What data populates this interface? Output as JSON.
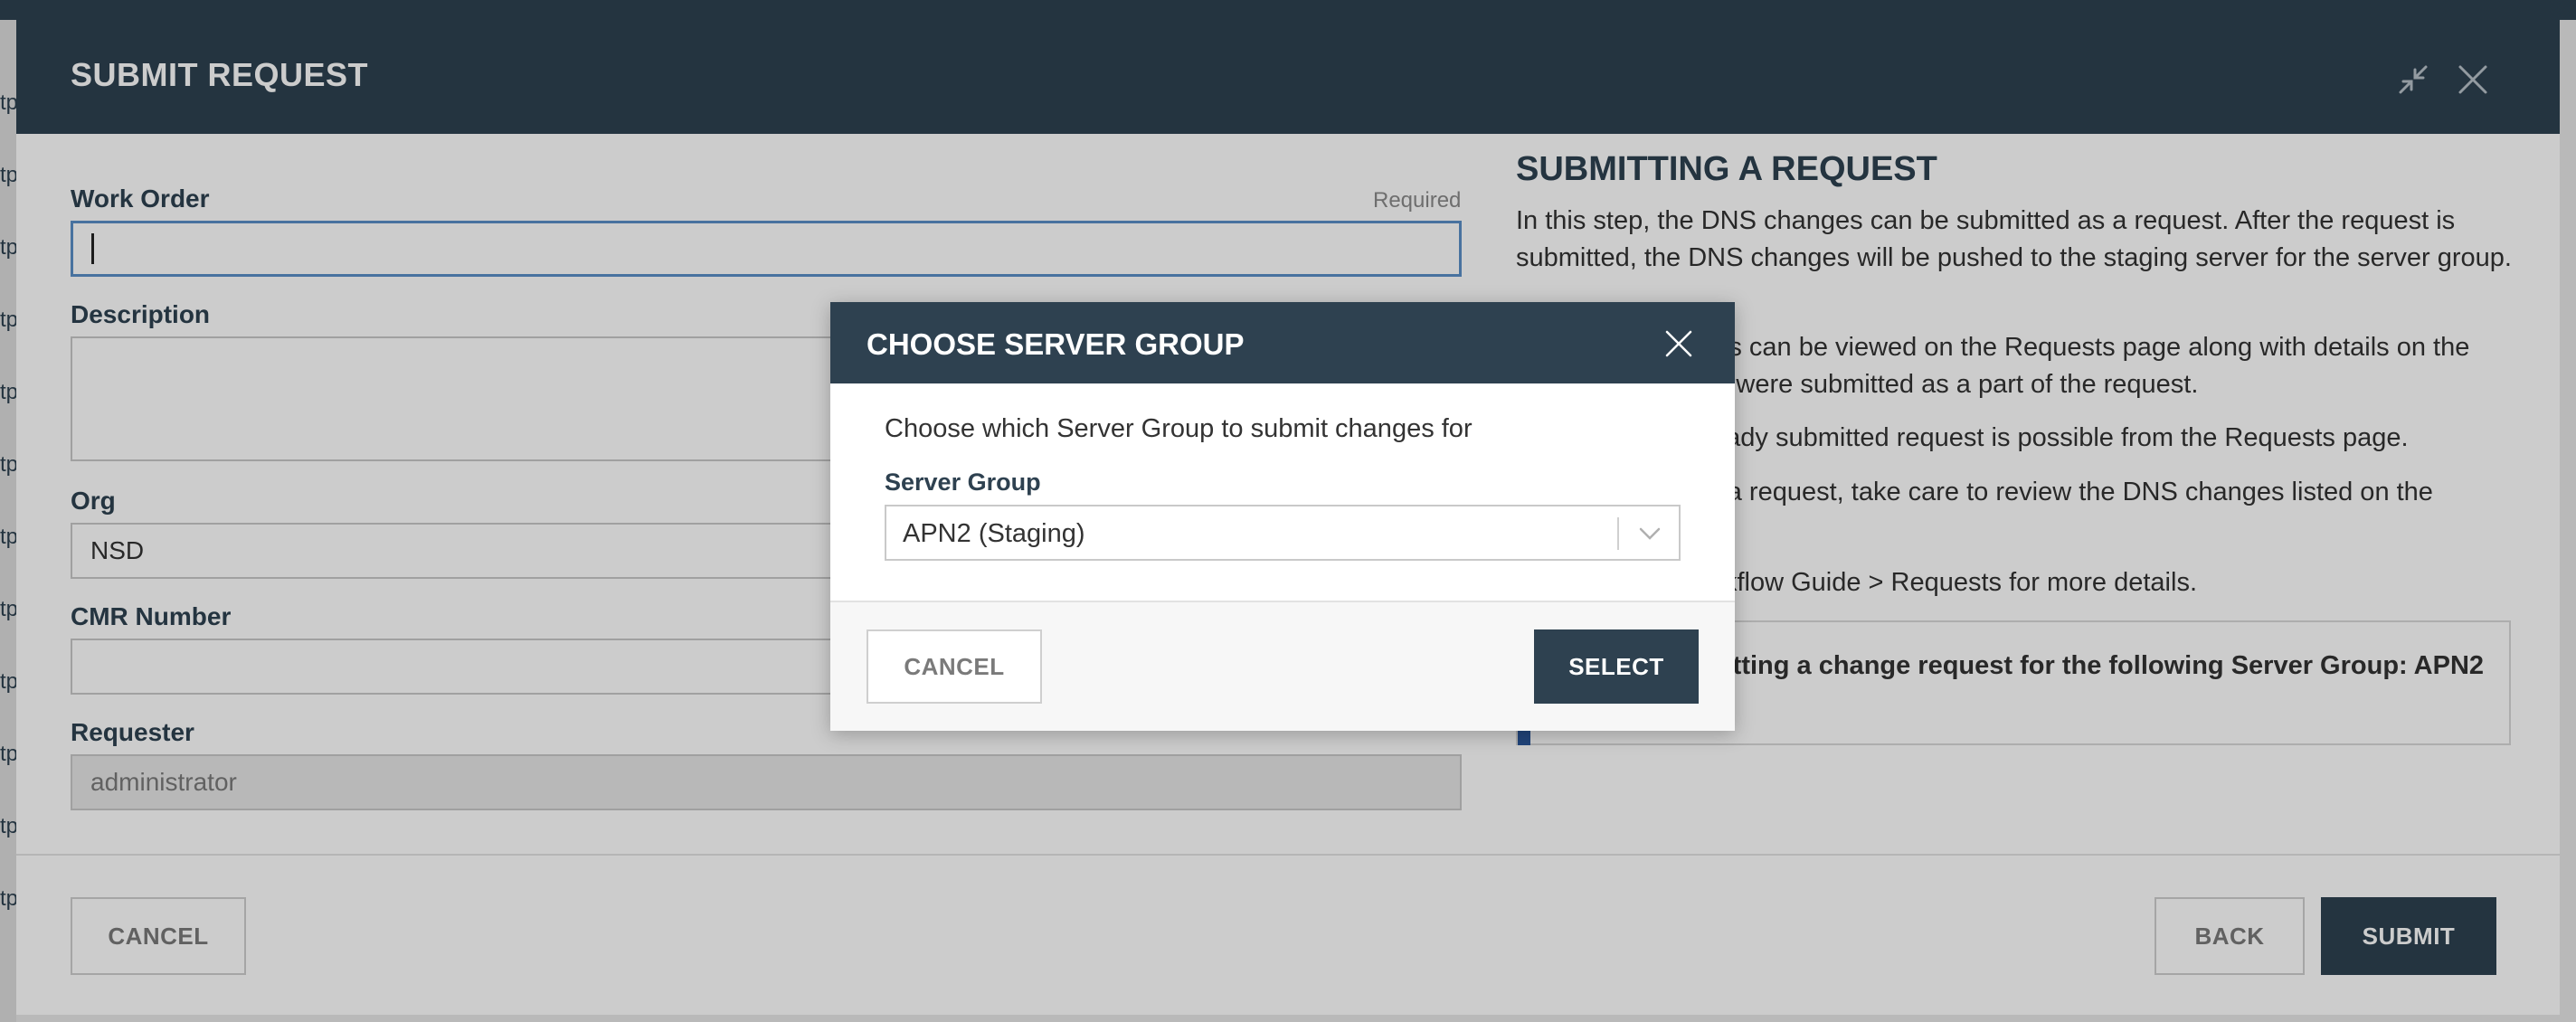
{
  "background": {
    "side_fragments": [
      "tp",
      "tp",
      "tp",
      "tp",
      "tp",
      "tp",
      "tp",
      "tp",
      "tp",
      "tp",
      "tp",
      "tp"
    ]
  },
  "dialog": {
    "title": "SUBMIT REQUEST",
    "icons": {
      "minimize": "compress-arrows-icon",
      "close": "close-x-icon"
    },
    "form": {
      "work_order": {
        "label": "Work Order",
        "required": "Required",
        "value": ""
      },
      "description": {
        "label": "Description",
        "value": ""
      },
      "org": {
        "label": "Org",
        "value": "NSD"
      },
      "cmr_number": {
        "label": "CMR Number",
        "value": ""
      },
      "requester": {
        "label": "Requester",
        "value": "administrator"
      }
    },
    "info": {
      "title": "SUBMITTING A REQUEST",
      "para1": "In this step, the DNS changes can be submitted as a request. After the request is submitted, the DNS changes will be pushed to the staging server for the server group.",
      "para2": "Submitted requests can be viewed on the Requests page along with details on the DNS changes that were submitted as a part of the request.",
      "para3": "Cancelling an already submitted request is possible from the Requests page.",
      "para4": "Before submitting a request, take care to review the DNS changes listed on the previous step.",
      "para5": "See the DNS Workflow Guide > Requests for more details.",
      "notice": "You are submitting a change request for the following Server Group: APN2 (Staging)"
    },
    "footer": {
      "cancel": "CANCEL",
      "back": "BACK",
      "submit": "SUBMIT"
    }
  },
  "modal": {
    "title": "CHOOSE SERVER GROUP",
    "close_icon": "close-x-icon",
    "description": "Choose which Server Group to submit changes for",
    "server_group": {
      "label": "Server Group",
      "value": "APN2 (Staging)"
    },
    "footer": {
      "cancel": "CANCEL",
      "select": "SELECT"
    }
  },
  "colors": {
    "header": "#2e4150",
    "accent_focus": "#5b8fc7",
    "notice_accent": "#2a5599"
  }
}
